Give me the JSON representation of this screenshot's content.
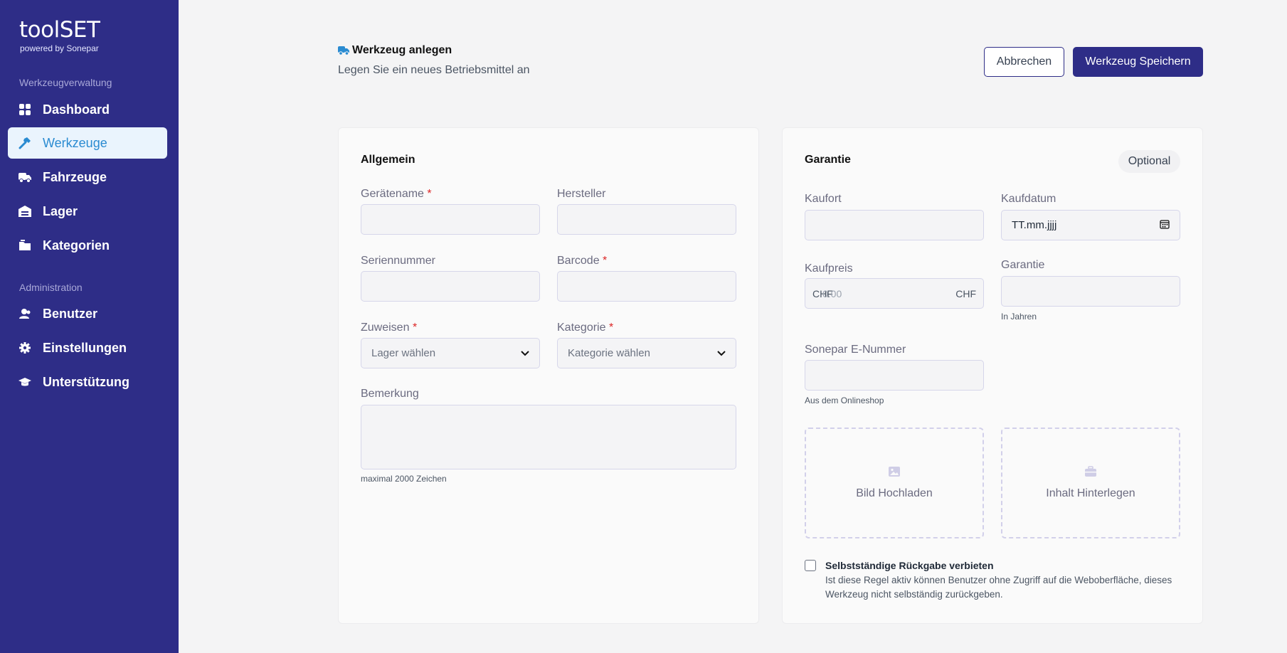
{
  "app": {
    "logo": "toolSET",
    "logo_sub": "powered by Sonepar"
  },
  "sidebar": {
    "sections": [
      {
        "title": "Werkzeugverwaltung"
      },
      {
        "title": "Administration"
      }
    ],
    "items": [
      {
        "label": "Dashboard",
        "icon": "dashboard-icon"
      },
      {
        "label": "Werkzeuge",
        "icon": "hammer-icon",
        "active": true
      },
      {
        "label": "Fahrzeuge",
        "icon": "truck-icon"
      },
      {
        "label": "Lager",
        "icon": "warehouse-icon"
      },
      {
        "label": "Kategorien",
        "icon": "folder-icon"
      },
      {
        "label": "Benutzer",
        "icon": "users-icon"
      },
      {
        "label": "Einstellungen",
        "icon": "gear-icon"
      },
      {
        "label": "Unterstützung",
        "icon": "graduation-cap-icon"
      }
    ]
  },
  "header": {
    "title": "Werkzeug anlegen",
    "subtitle": "Legen Sie ein neues Betriebsmittel an",
    "cancel_label": "Abbrechen",
    "save_label": "Werkzeug Speichern"
  },
  "general": {
    "title": "Allgemein",
    "device_name_label": "Gerätename",
    "manufacturer_label": "Hersteller",
    "serial_label": "Seriennummer",
    "barcode_label": "Barcode",
    "assign_label": "Zuweisen",
    "assign_value": "Lager wählen",
    "category_label": "Kategorie",
    "category_value": "Kategorie wählen",
    "remark_label": "Bemerkung",
    "remark_hint": "maximal 2000 Zeichen",
    "required_mark": "*"
  },
  "warranty": {
    "title": "Garantie",
    "optional": "Optional",
    "purchase_place_label": "Kaufort",
    "purchase_date_label": "Kaufdatum",
    "purchase_date_placeholder": "TT.mm.jjjj",
    "price_label": "Kaufpreis",
    "price_prefix": "CHF",
    "price_placeholder": "0.00",
    "price_suffix": "CHF",
    "warranty_label": "Garantie",
    "warranty_hint": "In Jahren",
    "enumber_label": "Sonepar E-Nummer",
    "enumber_hint": "Aus dem Onlineshop",
    "upload_image_label": "Bild Hochladen",
    "upload_content_label": "Inhalt Hinterlegen",
    "self_return_label": "Selbstständige Rückgabe verbieten",
    "self_return_desc": "Ist diese Regel aktiv können Benutzer ohne Zugriff auf die Weboberfläche, dieses Werkzeug nicht selbständig zurückgeben.",
    "self_return_checked": false
  },
  "colors": {
    "sidebar_bg": "#2e2d87",
    "accent": "#2a8bd1",
    "required": "#dc2626"
  }
}
